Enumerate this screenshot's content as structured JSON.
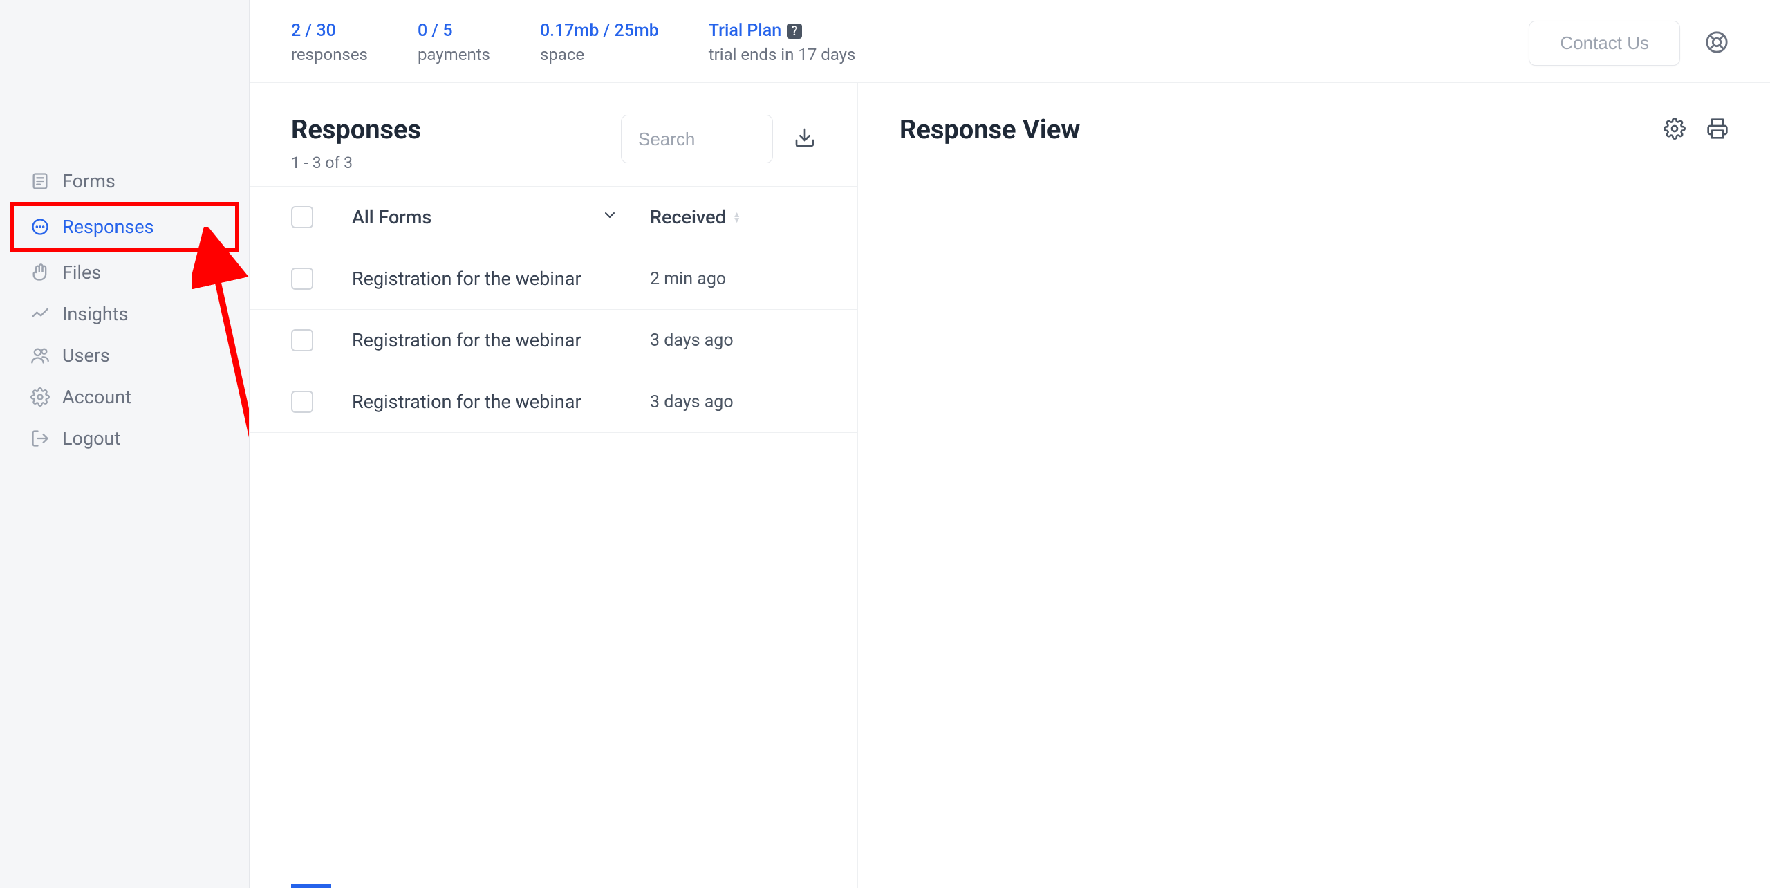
{
  "sidebar": {
    "items": [
      {
        "label": "Forms"
      },
      {
        "label": "Responses"
      },
      {
        "label": "Files"
      },
      {
        "label": "Insights"
      },
      {
        "label": "Users"
      },
      {
        "label": "Account"
      },
      {
        "label": "Logout"
      }
    ],
    "active_index": 1
  },
  "stats": {
    "responses": {
      "value": "2 / 30",
      "label": "responses"
    },
    "payments": {
      "value": "0 / 5",
      "label": "payments"
    },
    "space": {
      "value": "0.17mb / 25mb",
      "label": "space"
    },
    "plan": {
      "value": "Trial Plan",
      "help": "?",
      "label": "trial ends in 17 days"
    }
  },
  "topbar": {
    "contact": "Contact Us"
  },
  "left_panel": {
    "title": "Responses",
    "sub": "1 - 3 of 3",
    "search_placeholder": "Search",
    "columns": {
      "forms": "All Forms",
      "received": "Received"
    },
    "rows": [
      {
        "form": "Registration for the webinar",
        "received": "2 min ago"
      },
      {
        "form": "Registration for the webinar",
        "received": "3 days ago"
      },
      {
        "form": "Registration for the webinar",
        "received": "3 days ago"
      }
    ]
  },
  "right_panel": {
    "title": "Response View"
  }
}
